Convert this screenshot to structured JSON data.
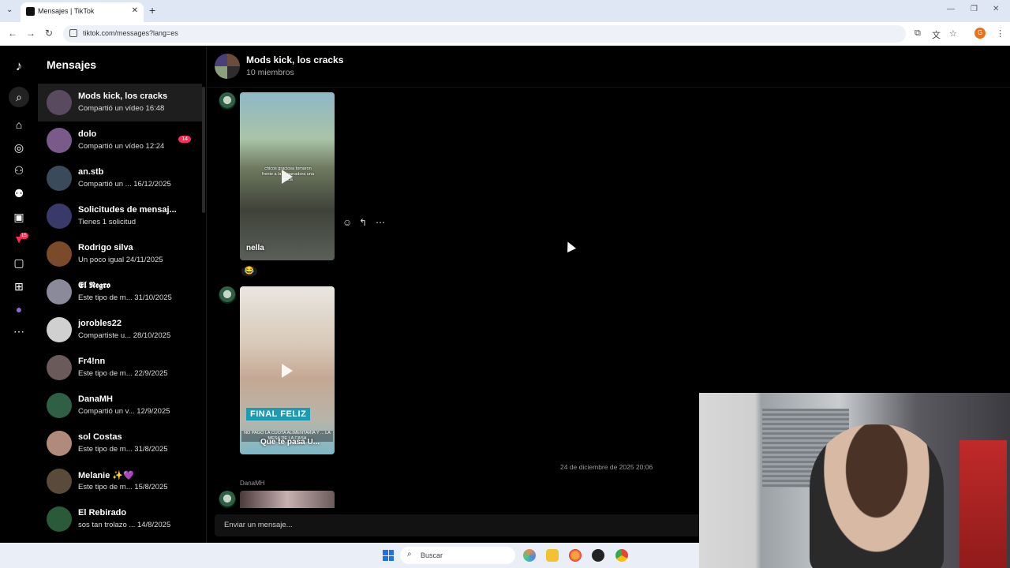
{
  "browser": {
    "tab_title": "Mensajes | TikTok",
    "url": "tiktok.com/messages?lang=es",
    "profile_initial": "G"
  },
  "sidebar": {
    "title": "Mensajes",
    "rail_badge": "15"
  },
  "conversations": [
    {
      "name": "Mods kick, los cracks",
      "sub": "Compartió un vídeo 16:48",
      "unread": "",
      "color": "#5a4a60"
    },
    {
      "name": "dolo",
      "sub": "Compartió un vídeo 12:24",
      "unread": "14",
      "color": "#7a5a8a"
    },
    {
      "name": "an.stb",
      "sub": "Compartió un ...  16/12/2025",
      "unread": "",
      "color": "#3a4a5a"
    },
    {
      "name": "Solicitudes de mensaj...",
      "sub": "Tienes 1 solicitud",
      "unread": "",
      "color": "#3a3a6a"
    },
    {
      "name": "Rodrigo silva",
      "sub": "Un poco igual 24/11/2025",
      "unread": "",
      "color": "#7a4a2a"
    },
    {
      "name": "𝕰𝖑 𝕹𝖊𝖌𝖗𝖔",
      "sub": "Este tipo de m...  31/10/2025",
      "unread": "",
      "color": "#8a8a9a"
    },
    {
      "name": "jorobles22",
      "sub": "Compartiste u...  28/10/2025",
      "unread": "",
      "color": "#d0d0d0"
    },
    {
      "name": "Fr4!nn",
      "sub": "Este tipo de m...  22/9/2025",
      "unread": "",
      "color": "#6a5a5a"
    },
    {
      "name": "DanaMH",
      "sub": "Compartió un v...  12/9/2025",
      "unread": "",
      "color": "#2f5f45"
    },
    {
      "name": "sol Costas",
      "sub": "Este tipo de m...  31/8/2025",
      "unread": "",
      "color": "#b08a7a"
    },
    {
      "name": "Melanie ✨💜",
      "sub": "Este tipo de m...  15/8/2025",
      "unread": "",
      "color": "#5a4a3a"
    },
    {
      "name": "El Rebirado",
      "sub": "sos tan trolazo ...  14/8/2025",
      "unread": "",
      "color": "#2a5a3a"
    }
  ],
  "chat": {
    "title": "Mods kick, los cracks",
    "members": "10 miembros",
    "video1_caption": "nella",
    "video1_overlay": "chicos graciosa tomaron frente a la ... ganadora una coca",
    "reaction": "😂",
    "video2_banner": "FINAL FELIZ",
    "video2_small": "NO PAGO LA CUOTA ALIMENTARIA Y ... LA MESA DE LA CASA",
    "video2_caption": "Que te pasa U...",
    "timestamp": "24 de diciembre de 2025 20:06",
    "sender": "DanaMH",
    "composer_placeholder": "Enviar un mensaje..."
  },
  "taskbar": {
    "search_label": "Buscar"
  }
}
